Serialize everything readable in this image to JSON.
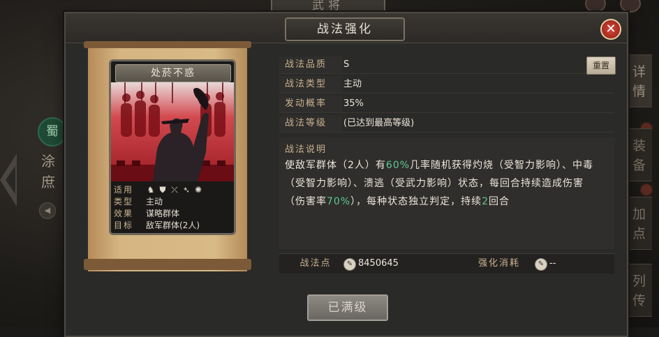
{
  "background": {
    "top_tab_label": "武将",
    "left_faction": "蜀",
    "left_name": "涂庶",
    "side_tabs": [
      {
        "label": "详情"
      },
      {
        "label": "装备"
      },
      {
        "label": "加点"
      },
      {
        "label": "列传"
      }
    ]
  },
  "dialog": {
    "title": "战法强化",
    "close_icon": "close-icon"
  },
  "card": {
    "name": "处菸不惑",
    "info": [
      {
        "key": "适用",
        "value": ""
      },
      {
        "key": "类型",
        "value": "主动"
      },
      {
        "key": "效果",
        "value": "谋略群体"
      },
      {
        "key": "目标",
        "value": "敌军群体(2人)"
      }
    ],
    "unit_icons": [
      "cavalry-icon",
      "shield-icon",
      "bow-icon",
      "spear-icon",
      "wheel-icon"
    ]
  },
  "properties": [
    {
      "key": "战法品质",
      "value": "S"
    },
    {
      "key": "战法类型",
      "value": "主动"
    },
    {
      "key": "发动概率",
      "value": "35%"
    },
    {
      "key": "战法等级",
      "value": "(已达到最高等级)"
    }
  ],
  "reset_label": "重置",
  "description": {
    "title": "战法说明",
    "parts": [
      {
        "text": "使敌军群体（2人）有",
        "hl": false
      },
      {
        "text": "60%",
        "hl": true
      },
      {
        "text": "几率随机获得灼烧（受智力影响）、中毒（受智力影响）、溃逃（受武力影响）状态，每回合持续造成伤害（伤害率",
        "hl": false
      },
      {
        "text": "70%",
        "hl": true
      },
      {
        "text": "），每种状态独立判定，持续",
        "hl": false
      },
      {
        "text": "2",
        "hl": true
      },
      {
        "text": "回合",
        "hl": false
      }
    ]
  },
  "bottom": {
    "points_label": "战法点",
    "points_value": "8450645",
    "cost_label": "强化消耗",
    "cost_value": "--"
  },
  "maxed_label": "已满级",
  "colors": {
    "highlight": "#5fc98e",
    "label_gold": "#c9b28f",
    "close_red": "#d8473a"
  }
}
